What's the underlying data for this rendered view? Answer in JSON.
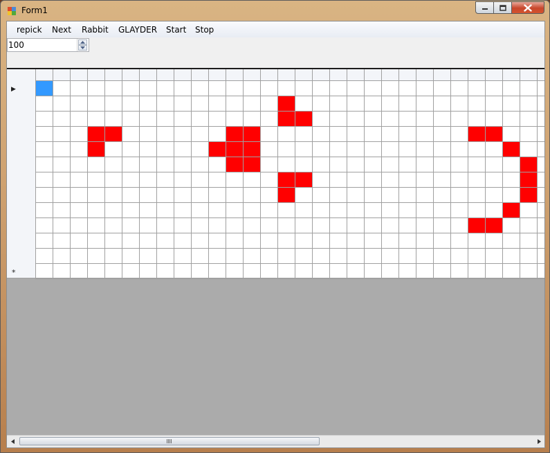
{
  "window": {
    "title": "Form1"
  },
  "menu": {
    "items": [
      "repick",
      "Next",
      "Rabbit",
      "GLAYDER",
      "Start",
      "Stop"
    ]
  },
  "numeric": {
    "value": "100"
  },
  "grid": {
    "columns": 29,
    "rows": 13,
    "current_row_glyph": "▶",
    "new_row_glyph": "*",
    "selected_cell": [
      0,
      0
    ],
    "selected_color": "#3399ff",
    "live_color": "#ff0000",
    "live_cells": [
      [
        1,
        14
      ],
      [
        2,
        14
      ],
      [
        2,
        15
      ],
      [
        3,
        3
      ],
      [
        3,
        4
      ],
      [
        4,
        3
      ],
      [
        3,
        11
      ],
      [
        3,
        12
      ],
      [
        4,
        10
      ],
      [
        4,
        11
      ],
      [
        4,
        12
      ],
      [
        5,
        11
      ],
      [
        5,
        12
      ],
      [
        6,
        14
      ],
      [
        6,
        15
      ],
      [
        7,
        14
      ],
      [
        3,
        25
      ],
      [
        3,
        26
      ],
      [
        4,
        27
      ],
      [
        5,
        28
      ],
      [
        6,
        28
      ],
      [
        7,
        28
      ],
      [
        8,
        27
      ],
      [
        9,
        25
      ],
      [
        9,
        26
      ]
    ]
  }
}
